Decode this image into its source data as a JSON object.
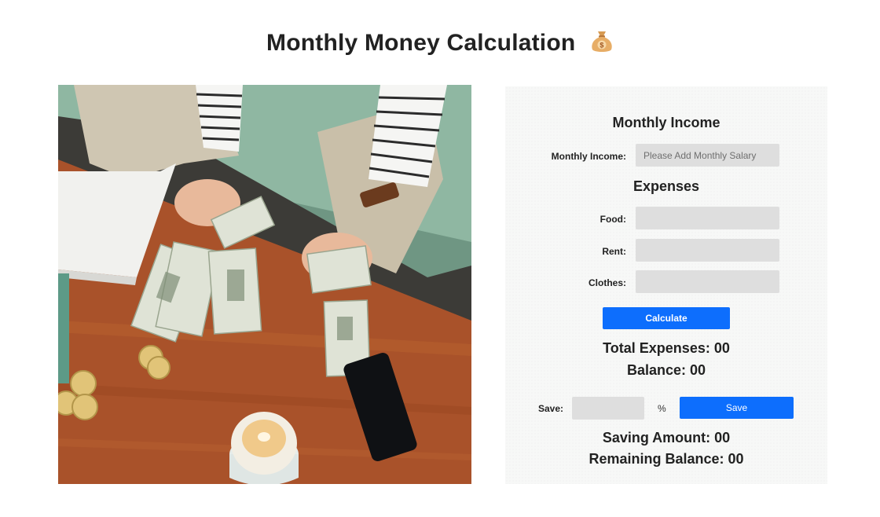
{
  "header": {
    "title": "Monthly Money Calculation",
    "icon": "money-bag-icon"
  },
  "income": {
    "heading": "Monthly Income",
    "label": "Monthly Income:",
    "placeholder": "Please Add Monthly Salary",
    "value": ""
  },
  "expenses": {
    "heading": "Expenses",
    "items": [
      {
        "label": "Food:",
        "value": ""
      },
      {
        "label": "Rent:",
        "value": ""
      },
      {
        "label": "Clothes:",
        "value": ""
      }
    ],
    "calculate_label": "Calculate",
    "total_text": "Total Expenses: 00",
    "balance_text": "Balance: 00"
  },
  "saving": {
    "label": "Save:",
    "value": "",
    "percent_sign": "%",
    "save_label": "Save",
    "saving_amount_text": "Saving Amount: 00",
    "remaining_text": "Remaining Balance: 00"
  },
  "colors": {
    "accent": "#0d6efd",
    "field": "#dedede",
    "panel": "#f7f8f7"
  }
}
